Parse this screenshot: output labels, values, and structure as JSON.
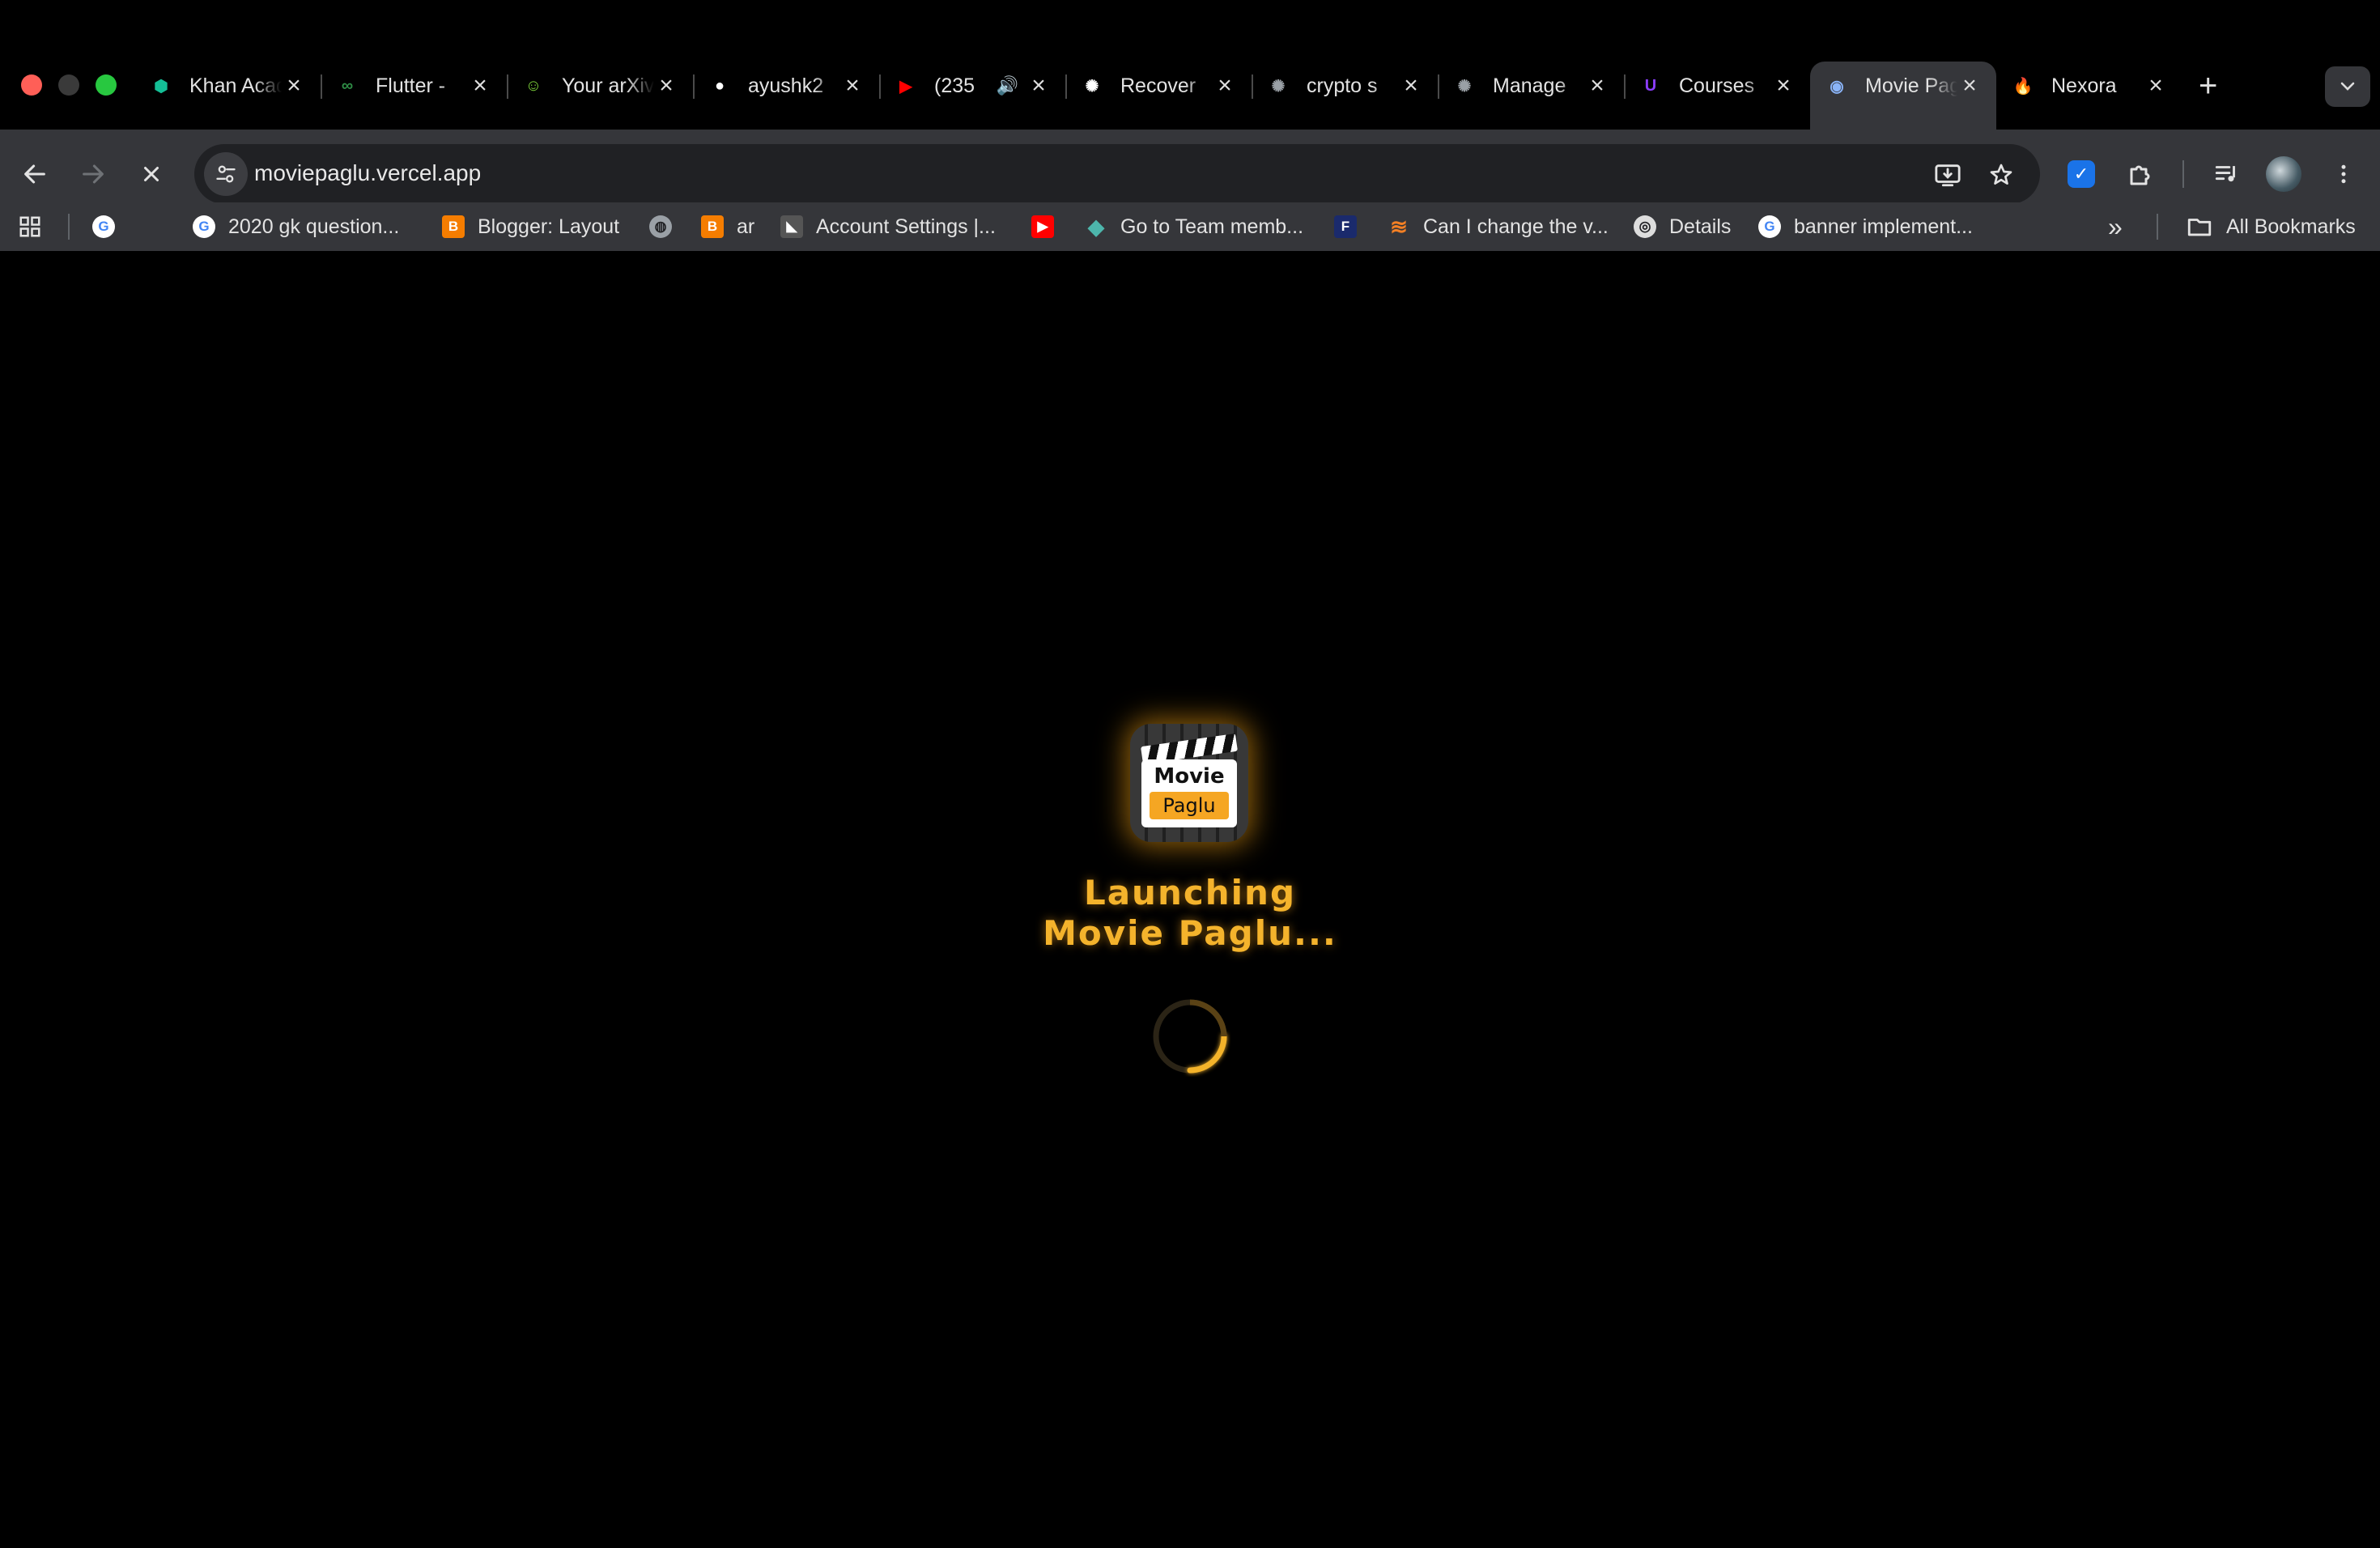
{
  "browser": {
    "tabs": [
      {
        "title": "Khan Academy",
        "icon": "khan-academy-icon",
        "color": "#14bf96",
        "glyph": "⬢"
      },
      {
        "title": "Flutter - ",
        "icon": "geeksforgeeks-icon",
        "color": "#2f8d46",
        "glyph": "∞"
      },
      {
        "title": "Your arXiv",
        "icon": "smiley-icon",
        "color": "#7fd43b",
        "glyph": "☺"
      },
      {
        "title": "ayushk2",
        "icon": "github-icon",
        "color": "#ffffff",
        "glyph": "●"
      },
      {
        "title": "(235",
        "icon": "youtube-icon",
        "color": "#ff0000",
        "glyph": "▶",
        "audio": "🔊"
      },
      {
        "title": "Recover",
        "icon": "openai-icon",
        "color": "#ffffff",
        "glyph": "✺"
      },
      {
        "title": "crypto s",
        "icon": "chatgpt-icon",
        "color": "#9aa0a6",
        "glyph": "✺"
      },
      {
        "title": "Manage",
        "icon": "chatgpt-icon",
        "color": "#9aa0a6",
        "glyph": "✺"
      },
      {
        "title": "Courses",
        "icon": "course-icon",
        "color": "#8b3dff",
        "glyph": "U"
      },
      {
        "title": "Movie Paglu",
        "icon": "movie-paglu-icon",
        "color": "#8ab4f8",
        "glyph": "◉",
        "active": true
      },
      {
        "title": "Nexora",
        "icon": "fire-icon",
        "color": "#ff7a1a",
        "glyph": "🔥"
      }
    ],
    "url": "moviepaglu.vercel.app",
    "bookmarks": [
      {
        "label": "",
        "icon": "google-icon"
      },
      {
        "label": "2020 gk question...",
        "icon": "google-icon"
      },
      {
        "label": "Blogger: Layout",
        "icon": "blogger-icon"
      },
      {
        "label": "",
        "icon": "globe-icon"
      },
      {
        "label": "ar",
        "icon": "blogger-icon"
      },
      {
        "label": "Account Settings |...",
        "icon": "account-icon"
      },
      {
        "label": "",
        "icon": "youtube-icon"
      },
      {
        "label": "Go to Team memb...",
        "icon": "diamond-icon"
      },
      {
        "label": "",
        "icon": "f-icon"
      },
      {
        "label": "Can I change the v...",
        "icon": "stackoverflow-icon"
      },
      {
        "label": "Details",
        "icon": "details-icon"
      },
      {
        "label": "banner implement...",
        "icon": "google-icon"
      }
    ],
    "all_bookmarks_label": "All Bookmarks"
  },
  "page": {
    "logo": {
      "line1": "Movie",
      "line2": "Paglu"
    },
    "launch_line1": "Launching",
    "launch_line2": "Movie Paglu...",
    "accent_color": "#f4b32c"
  }
}
